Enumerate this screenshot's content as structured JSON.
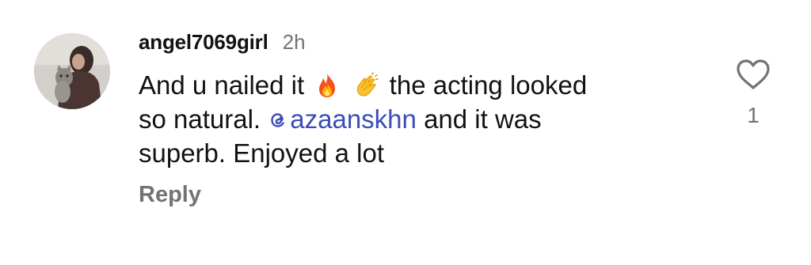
{
  "comment": {
    "username": "angel7069girl",
    "timestamp": "2h",
    "text": {
      "line1_pre": "And u nailed it",
      "emoji_fire": "🔥",
      "emoji_clap": "👏",
      "line1_post": "the acting looked",
      "line2_pre": "so natural.",
      "mention": "azaanskhn",
      "line2_post": "and it was",
      "line3": "superb. Enjoyed a lot"
    },
    "reply_label": "Reply",
    "like_count": "1"
  },
  "colors": {
    "mention": "#3b4db8",
    "secondary_text": "#737373",
    "primary_text": "#121212"
  },
  "icons": {
    "like": "heart-outline-icon",
    "mention": "threads-icon"
  }
}
